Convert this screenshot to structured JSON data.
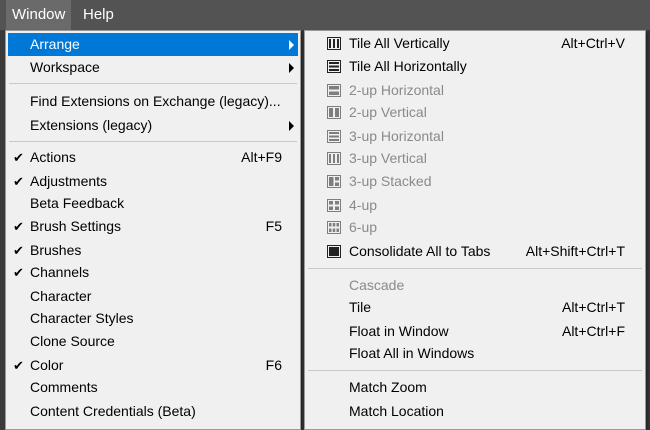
{
  "menubar": {
    "window": "Window",
    "help": "Help"
  },
  "window_menu": {
    "items": [
      {
        "label": "Arrange",
        "shortcut": "",
        "checked": false,
        "submenu": true,
        "highlight": true
      },
      {
        "label": "Workspace",
        "shortcut": "",
        "checked": false,
        "submenu": true
      },
      {
        "label": "Find Extensions on Exchange (legacy)...",
        "shortcut": "",
        "checked": false
      },
      {
        "label": "Extensions (legacy)",
        "shortcut": "",
        "checked": false,
        "submenu": true
      },
      {
        "label": "Actions",
        "shortcut": "Alt+F9",
        "checked": true
      },
      {
        "label": "Adjustments",
        "shortcut": "",
        "checked": true
      },
      {
        "label": "Beta Feedback",
        "shortcut": "",
        "checked": false
      },
      {
        "label": "Brush Settings",
        "shortcut": "F5",
        "checked": true
      },
      {
        "label": "Brushes",
        "shortcut": "",
        "checked": true
      },
      {
        "label": "Channels",
        "shortcut": "",
        "checked": true
      },
      {
        "label": "Character",
        "shortcut": "",
        "checked": false
      },
      {
        "label": "Character Styles",
        "shortcut": "",
        "checked": false
      },
      {
        "label": "Clone Source",
        "shortcut": "",
        "checked": false
      },
      {
        "label": "Color",
        "shortcut": "F6",
        "checked": true
      },
      {
        "label": "Comments",
        "shortcut": "",
        "checked": false
      },
      {
        "label": "Content Credentials (Beta)",
        "shortcut": "",
        "checked": false
      }
    ],
    "check_glyph": "✔"
  },
  "arrange_submenu": {
    "items": [
      {
        "label": "Tile All Vertically",
        "shortcut": "Alt+Ctrl+V",
        "icon": "tile-vertical-icon",
        "disabled": false
      },
      {
        "label": "Tile All Horizontally",
        "shortcut": "",
        "icon": "tile-horizontal-icon",
        "disabled": false
      },
      {
        "label": "2-up Horizontal",
        "shortcut": "",
        "icon": "two-up-horizontal-icon",
        "disabled": true
      },
      {
        "label": "2-up Vertical",
        "shortcut": "",
        "icon": "two-up-vertical-icon",
        "disabled": true
      },
      {
        "label": "3-up Horizontal",
        "shortcut": "",
        "icon": "three-up-horizontal-icon",
        "disabled": true
      },
      {
        "label": "3-up Vertical",
        "shortcut": "",
        "icon": "three-up-vertical-icon",
        "disabled": true
      },
      {
        "label": "3-up Stacked",
        "shortcut": "",
        "icon": "three-up-stacked-icon",
        "disabled": true
      },
      {
        "label": "4-up",
        "shortcut": "",
        "icon": "four-up-icon",
        "disabled": true
      },
      {
        "label": "6-up",
        "shortcut": "",
        "icon": "six-up-icon",
        "disabled": true
      },
      {
        "label": "Consolidate All to Tabs",
        "shortcut": "Alt+Shift+Ctrl+T",
        "icon": "consolidate-tabs-icon",
        "disabled": false
      },
      {
        "label": "Cascade",
        "shortcut": "",
        "disabled": true
      },
      {
        "label": "Tile",
        "shortcut": "Alt+Ctrl+T",
        "disabled": false
      },
      {
        "label": "Float in Window",
        "shortcut": "Alt+Ctrl+F",
        "disabled": false
      },
      {
        "label": "Float All in Windows",
        "shortcut": "",
        "disabled": false
      },
      {
        "label": "Match Zoom",
        "shortcut": "",
        "disabled": false
      },
      {
        "label": "Match Location",
        "shortcut": "",
        "disabled": false
      }
    ]
  }
}
